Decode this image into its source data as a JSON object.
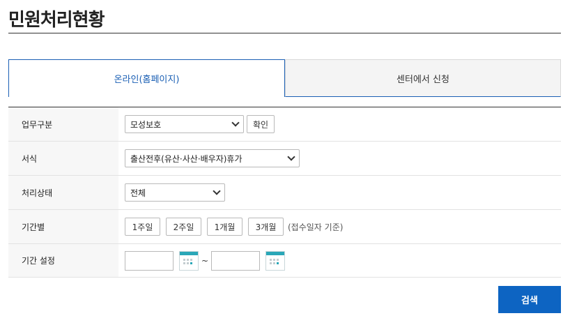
{
  "page": {
    "title": "민원처리현황"
  },
  "tabs": [
    {
      "label": "온라인(홈페이지)",
      "active": true
    },
    {
      "label": "센터에서 신청",
      "active": false
    }
  ],
  "form": {
    "business": {
      "label": "업무구분",
      "selected": "모성보호",
      "confirm_label": "확인"
    },
    "format": {
      "label": "서식",
      "selected": "출산전후(유산·사산·배우자)휴가"
    },
    "status": {
      "label": "처리상태",
      "selected": "전체"
    },
    "period": {
      "label": "기간별",
      "options": [
        "1주일",
        "2주일",
        "1개월",
        "3개월"
      ],
      "note": "(접수일자 기준)"
    },
    "date_range": {
      "label": "기간 설정",
      "start": "",
      "end": "",
      "separator": "~"
    }
  },
  "actions": {
    "search_label": "검색"
  },
  "colors": {
    "accent": "#0d64c2",
    "tab_accent": "#1a5fb4",
    "calendar": "#2aa7b8"
  }
}
